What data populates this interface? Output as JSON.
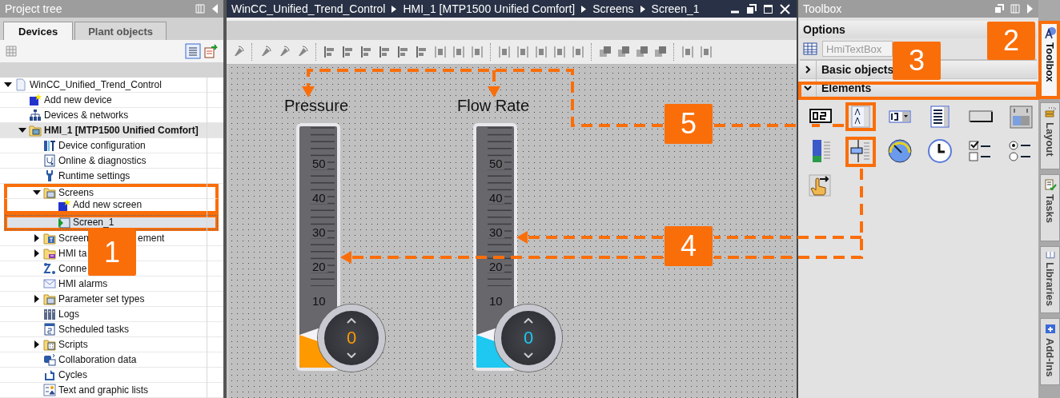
{
  "project_tree": {
    "title": "Project tree",
    "tabs": [
      {
        "label": "Devices",
        "selected": true
      },
      {
        "label": "Plant objects",
        "selected": false
      }
    ]
  },
  "tree": [
    {
      "label": "WinCC_Unified_Trend_Control",
      "kind": "project",
      "expanded": true,
      "selected": false,
      "children": [
        {
          "label": "Add new device",
          "kind": "add",
          "selected": false
        },
        {
          "label": "Devices & networks",
          "kind": "network",
          "selected": false
        },
        {
          "label": "HMI_1 [MTP1500 Unified Comfort]",
          "kind": "device",
          "expanded": true,
          "selected": false,
          "children": [
            {
              "label": "Device configuration",
              "kind": "config",
              "selected": false
            },
            {
              "label": "Online & diagnostics",
              "kind": "diagnostics",
              "selected": false
            },
            {
              "label": "Runtime settings",
              "kind": "settings",
              "selected": false
            },
            {
              "label": "Screens",
              "kind": "folder",
              "expanded": true,
              "selected": false,
              "children": [
                {
                  "label": "Add new screen",
                  "kind": "add",
                  "selected": false
                },
                {
                  "label": "Screen_1",
                  "kind": "screen",
                  "selected": true
                }
              ]
            },
            {
              "label": "Screen",
              "label_end": "ement",
              "kind": "tool-folder",
              "expanded": false,
              "selected": false
            },
            {
              "label": "HMI ta",
              "kind": "tag-folder",
              "expanded": false,
              "selected": false
            },
            {
              "label": "Conne",
              "kind": "connections",
              "selected": false
            },
            {
              "label": "HMI alarms",
              "kind": "alarms",
              "selected": false
            },
            {
              "label": "Parameter set types",
              "kind": "folder",
              "expanded": false,
              "selected": false
            },
            {
              "label": "Logs",
              "kind": "logs",
              "selected": false
            },
            {
              "label": "Scheduled tasks",
              "kind": "schedule",
              "selected": false
            },
            {
              "label": "Scripts",
              "kind": "script-folder",
              "expanded": false,
              "selected": false
            },
            {
              "label": "Collaboration data",
              "kind": "collab",
              "selected": false
            },
            {
              "label": "Cycles",
              "kind": "cycles",
              "selected": false
            },
            {
              "label": "Text and graphic lists",
              "kind": "lists",
              "selected": false
            }
          ]
        }
      ]
    }
  ],
  "editor": {
    "breadcrumb": [
      "WinCC_Unified_Trend_Control",
      "HMI_1 [MTP1500 Unified Comfort]",
      "Screens",
      "Screen_1"
    ]
  },
  "sliders": [
    {
      "label": "Pressure",
      "ticks": [
        "50",
        "40",
        "30",
        "20",
        "10"
      ],
      "value": "0",
      "color": "#ff9900"
    },
    {
      "label": "Flow Rate",
      "ticks": [
        "50",
        "40",
        "30",
        "20",
        "10"
      ],
      "value": "0",
      "color": "#1ec8f0"
    }
  ],
  "toolbox": {
    "title": "Toolbox",
    "options_title": "Options",
    "field": {
      "placeholder": "HmiTextBox"
    },
    "sections": [
      {
        "title": "Basic objects",
        "expanded": false
      },
      {
        "title": "Elements",
        "expanded": true
      }
    ]
  },
  "side_tabs": [
    {
      "label": "Toolbox",
      "kind": "toolbox",
      "selected": true
    },
    {
      "label": "Layout",
      "kind": "layout",
      "selected": false
    },
    {
      "label": "Tasks",
      "kind": "tasks",
      "selected": false
    },
    {
      "label": "Libraries",
      "kind": "libraries",
      "selected": false
    },
    {
      "label": "Add-Ins",
      "kind": "addins",
      "selected": false
    }
  ],
  "callouts": [
    {
      "label": "1"
    },
    {
      "label": "2"
    },
    {
      "label": "3"
    },
    {
      "label": "4"
    },
    {
      "label": "5"
    }
  ]
}
